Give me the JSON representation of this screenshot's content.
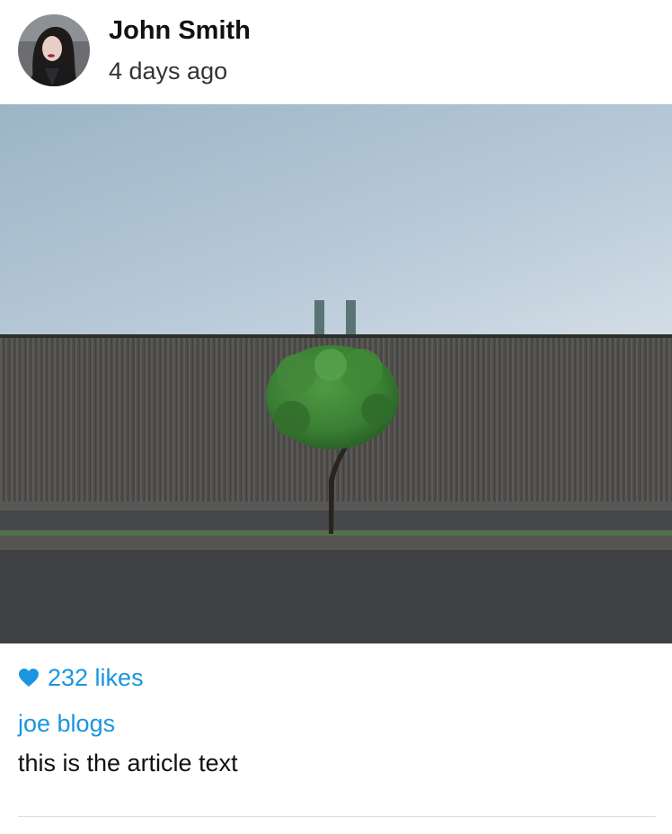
{
  "post": {
    "author": {
      "name": "John Smith",
      "avatar_icon": "profile-photo"
    },
    "timestamp": "4 days ago",
    "likes": {
      "icon": "heart-icon",
      "label": "232 likes"
    },
    "comment": {
      "author": "joe blogs",
      "text": "this is the article text"
    }
  },
  "colors": {
    "accent": "#1a95e0",
    "text_primary": "#111111",
    "text_secondary": "#333333",
    "divider": "#dedede"
  }
}
